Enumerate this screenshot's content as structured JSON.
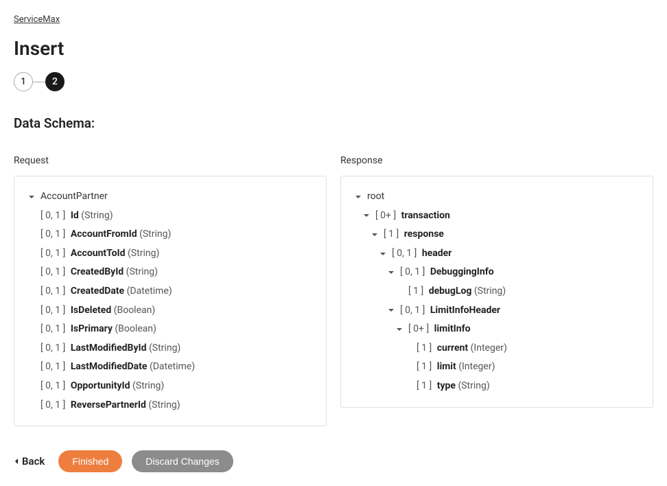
{
  "breadcrumb": "ServiceMax",
  "page_title": "Insert",
  "steps": {
    "step1": "1",
    "step2": "2"
  },
  "section_title": "Data Schema:",
  "request": {
    "title": "Request",
    "root": {
      "name": "AccountPartner",
      "fields": [
        {
          "cardinality": "[ 0, 1 ]",
          "name": "Id",
          "type": "(String)"
        },
        {
          "cardinality": "[ 0, 1 ]",
          "name": "AccountFromId",
          "type": "(String)"
        },
        {
          "cardinality": "[ 0, 1 ]",
          "name": "AccountToId",
          "type": "(String)"
        },
        {
          "cardinality": "[ 0, 1 ]",
          "name": "CreatedById",
          "type": "(String)"
        },
        {
          "cardinality": "[ 0, 1 ]",
          "name": "CreatedDate",
          "type": "(Datetime)"
        },
        {
          "cardinality": "[ 0, 1 ]",
          "name": "IsDeleted",
          "type": "(Boolean)"
        },
        {
          "cardinality": "[ 0, 1 ]",
          "name": "IsPrimary",
          "type": "(Boolean)"
        },
        {
          "cardinality": "[ 0, 1 ]",
          "name": "LastModifiedById",
          "type": "(String)"
        },
        {
          "cardinality": "[ 0, 1 ]",
          "name": "LastModifiedDate",
          "type": "(Datetime)"
        },
        {
          "cardinality": "[ 0, 1 ]",
          "name": "OpportunityId",
          "type": "(String)"
        },
        {
          "cardinality": "[ 0, 1 ]",
          "name": "ReversePartnerId",
          "type": "(String)"
        }
      ]
    }
  },
  "response": {
    "title": "Response",
    "root": {
      "name": "root"
    },
    "transaction_card": "[ 0+ ]",
    "transaction_name": "transaction",
    "response_card": "[ 1 ]",
    "response_name": "response",
    "header_card": "[ 0, 1 ]",
    "header_name": "header",
    "debugging_card": "[ 0, 1 ]",
    "debugging_name": "DebuggingInfo",
    "debuglog_card": "[ 1 ]",
    "debuglog_name": "debugLog",
    "debuglog_type": "(String)",
    "limitinfoheader_card": "[ 0, 1 ]",
    "limitinfoheader_name": "LimitInfoHeader",
    "limitinfo_card": "[ 0+ ]",
    "limitinfo_name": "limitInfo",
    "current_card": "[ 1 ]",
    "current_name": "current",
    "current_type": "(Integer)",
    "limit_card": "[ 1 ]",
    "limit_name": "limit",
    "limit_type": "(Integer)",
    "type_card": "[ 1 ]",
    "type_name": "type",
    "type_type": "(String)"
  },
  "buttons": {
    "back": "Back",
    "finished": "Finished",
    "discard": "Discard Changes"
  }
}
